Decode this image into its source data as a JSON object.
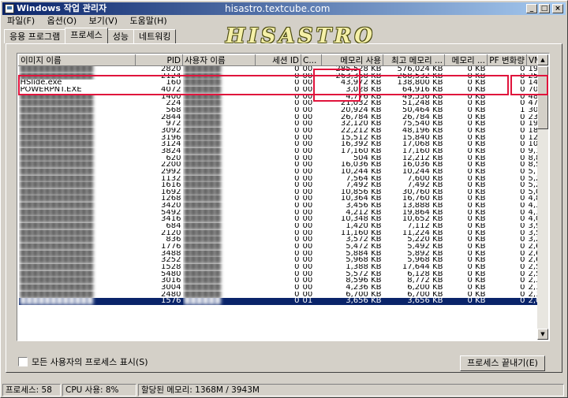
{
  "window": {
    "title": "Windows 작업 관리자",
    "watermark_url": "hisastro.textcube.com",
    "watermark_logo": "HISASTRO",
    "controls": [
      "_",
      "□",
      "×"
    ]
  },
  "menu": [
    "파일(F)",
    "옵션(O)",
    "보기(V)",
    "도움말(H)"
  ],
  "tabs": [
    {
      "label": "응용 프로그램",
      "active": false
    },
    {
      "label": "프로세스",
      "active": true
    },
    {
      "label": "성능",
      "active": false
    },
    {
      "label": "네트워킹",
      "active": false
    }
  ],
  "columns": [
    "이미지 이름",
    "PID",
    "사용자 이름",
    "세션 ID",
    "C...",
    "메모리 사용",
    "최고 메모리 ...",
    "메모리 ...",
    "PF 변화량",
    "VM 크"
  ],
  "rows": [
    {
      "name": "",
      "pid": "2820",
      "session": "0",
      "cpu": "00",
      "mem": "285,528 KB",
      "peak": "576,024 KB",
      "delta": "0 KB",
      "pf": "0",
      "vm": "199,400"
    },
    {
      "name": "",
      "pid": "2124",
      "session": "0",
      "cpu": "00",
      "mem": "263,368 KB",
      "peak": "268,532 KB",
      "delta": "0 KB",
      "pf": "0",
      "vm": "255,200"
    },
    {
      "name": "HSlide.exe",
      "pid": "160",
      "session": "0",
      "cpu": "00",
      "mem": "43,972 KB",
      "peak": "138,800 KB",
      "delta": "0 KB",
      "pf": "0",
      "vm": "147,880 K"
    },
    {
      "name": "POWERPNT.EXE",
      "pid": "4072",
      "session": "0",
      "cpu": "00",
      "mem": "3,028 KB",
      "peak": "64,916 KB",
      "delta": "0 KB",
      "pf": "0",
      "vm": "70,356"
    },
    {
      "name": "",
      "pid": "1400",
      "session": "0",
      "cpu": "00",
      "mem": "4,776 KB",
      "peak": "49,556 KB",
      "delta": "0 KB",
      "pf": "0",
      "vm": "48,876"
    },
    {
      "name": "",
      "pid": "224",
      "session": "0",
      "cpu": "00",
      "mem": "21,032 KB",
      "peak": "51,248 KB",
      "delta": "0 KB",
      "pf": "0",
      "vm": "47,836"
    },
    {
      "name": "",
      "pid": "568",
      "session": "0",
      "cpu": "00",
      "mem": "20,924 KB",
      "peak": "50,464 KB",
      "delta": "0 KB",
      "pf": "1",
      "vm": "30,708"
    },
    {
      "name": "",
      "pid": "2844",
      "session": "0",
      "cpu": "00",
      "mem": "26,784 KB",
      "peak": "26,784 KB",
      "delta": "0 KB",
      "pf": "0",
      "vm": "23,420"
    },
    {
      "name": "",
      "pid": "972",
      "session": "0",
      "cpu": "00",
      "mem": "32,120 KB",
      "peak": "75,540 KB",
      "delta": "0 KB",
      "pf": "0",
      "vm": "19,840"
    },
    {
      "name": "",
      "pid": "3092",
      "session": "0",
      "cpu": "00",
      "mem": "22,212 KB",
      "peak": "48,196 KB",
      "delta": "0 KB",
      "pf": "0",
      "vm": "18,360"
    },
    {
      "name": "",
      "pid": "3196",
      "session": "0",
      "cpu": "00",
      "mem": "15,512 KB",
      "peak": "15,840 KB",
      "delta": "0 KB",
      "pf": "0",
      "vm": "12,268"
    },
    {
      "name": "",
      "pid": "3124",
      "session": "0",
      "cpu": "00",
      "mem": "16,392 KB",
      "peak": "17,068 KB",
      "delta": "0 KB",
      "pf": "0",
      "vm": "10,028"
    },
    {
      "name": "",
      "pid": "3824",
      "session": "0",
      "cpu": "00",
      "mem": "17,160 KB",
      "peak": "17,160 KB",
      "delta": "0 KB",
      "pf": "0",
      "vm": "9,108"
    },
    {
      "name": "",
      "pid": "620",
      "session": "0",
      "cpu": "00",
      "mem": "504 KB",
      "peak": "12,212 KB",
      "delta": "0 KB",
      "pf": "0",
      "vm": "8,860"
    },
    {
      "name": "",
      "pid": "2200",
      "session": "0",
      "cpu": "00",
      "mem": "16,036 KB",
      "peak": "16,036 KB",
      "delta": "0 KB",
      "pf": "0",
      "vm": "8,512"
    },
    {
      "name": "",
      "pid": "2992",
      "session": "0",
      "cpu": "00",
      "mem": "10,244 KB",
      "peak": "10,244 KB",
      "delta": "0 KB",
      "pf": "0",
      "vm": "5,792"
    },
    {
      "name": "",
      "pid": "1132",
      "session": "0",
      "cpu": "00",
      "mem": "7,564 KB",
      "peak": "7,600 KB",
      "delta": "0 KB",
      "pf": "0",
      "vm": "5,288"
    },
    {
      "name": "",
      "pid": "1616",
      "session": "0",
      "cpu": "00",
      "mem": "7,492 KB",
      "peak": "7,492 KB",
      "delta": "0 KB",
      "pf": "0",
      "vm": "5,200"
    },
    {
      "name": "",
      "pid": "1692",
      "session": "0",
      "cpu": "00",
      "mem": "10,856 KB",
      "peak": "30,760 KB",
      "delta": "0 KB",
      "pf": "0",
      "vm": "5,032"
    },
    {
      "name": "",
      "pid": "1268",
      "session": "0",
      "cpu": "00",
      "mem": "10,364 KB",
      "peak": "16,760 KB",
      "delta": "0 KB",
      "pf": "0",
      "vm": "4,808"
    },
    {
      "name": "",
      "pid": "3420",
      "session": "0",
      "cpu": "00",
      "mem": "3,456 KB",
      "peak": "13,888 KB",
      "delta": "0 KB",
      "pf": "0",
      "vm": "4,300"
    },
    {
      "name": "",
      "pid": "5492",
      "session": "0",
      "cpu": "00",
      "mem": "4,212 KB",
      "peak": "19,864 KB",
      "delta": "0 KB",
      "pf": "0",
      "vm": "4,168"
    },
    {
      "name": "",
      "pid": "3416",
      "session": "0",
      "cpu": "00",
      "mem": "10,348 KB",
      "peak": "10,652 KB",
      "delta": "0 KB",
      "pf": "0",
      "vm": "4,000"
    },
    {
      "name": "",
      "pid": "684",
      "session": "0",
      "cpu": "00",
      "mem": "1,420 KB",
      "peak": "7,112 KB",
      "delta": "0 KB",
      "pf": "0",
      "vm": "3,968"
    },
    {
      "name": "",
      "pid": "2120",
      "session": "0",
      "cpu": "00",
      "mem": "11,160 KB",
      "peak": "11,224 KB",
      "delta": "0 KB",
      "pf": "0",
      "vm": "3,500"
    },
    {
      "name": "",
      "pid": "836",
      "session": "0",
      "cpu": "00",
      "mem": "3,572 KB",
      "peak": "5,220 KB",
      "delta": "0 KB",
      "pf": "0",
      "vm": "3,232"
    },
    {
      "name": "",
      "pid": "1776",
      "session": "0",
      "cpu": "00",
      "mem": "5,472 KB",
      "peak": "5,492 KB",
      "delta": "0 KB",
      "pf": "0",
      "vm": "2,620"
    },
    {
      "name": "",
      "pid": "3488",
      "session": "0",
      "cpu": "00",
      "mem": "5,884 KB",
      "peak": "5,892 KB",
      "delta": "0 KB",
      "pf": "0",
      "vm": "2,608"
    },
    {
      "name": "",
      "pid": "3252",
      "session": "0",
      "cpu": "00",
      "mem": "5,968 KB",
      "peak": "5,968 KB",
      "delta": "0 KB",
      "pf": "0",
      "vm": "2,600"
    },
    {
      "name": "",
      "pid": "1528",
      "session": "0",
      "cpu": "00",
      "mem": "1,388 KB",
      "peak": "17,644 KB",
      "delta": "0 KB",
      "pf": "0",
      "vm": "2,528"
    },
    {
      "name": "",
      "pid": "5480",
      "session": "0",
      "cpu": "00",
      "mem": "5,572 KB",
      "peak": "6,128 KB",
      "delta": "0 KB",
      "pf": "0",
      "vm": "2,520"
    },
    {
      "name": "",
      "pid": "3016",
      "session": "0",
      "cpu": "00",
      "mem": "8,596 KB",
      "peak": "8,772 KB",
      "delta": "0 KB",
      "pf": "0",
      "vm": "2,372"
    },
    {
      "name": "",
      "pid": "3004",
      "session": "0",
      "cpu": "00",
      "mem": "4,236 KB",
      "peak": "6,200 KB",
      "delta": "0 KB",
      "pf": "0",
      "vm": "2,144"
    },
    {
      "name": "",
      "pid": "2480",
      "session": "0",
      "cpu": "00",
      "mem": "6,700 KB",
      "peak": "6,700 KB",
      "delta": "0 KB",
      "pf": "0",
      "vm": "2,124"
    },
    {
      "name": "",
      "pid": "1576",
      "session": "0",
      "cpu": "01",
      "mem": "3,656 KB",
      "peak": "3,656 KB",
      "delta": "0 KB",
      "pf": "0",
      "vm": "2,076 K",
      "selected": true
    }
  ],
  "show_all_users_label": "모든 사용자의 프로세스 표시(S)",
  "end_process_label": "프로세스 끝내기(E)",
  "status": {
    "processes": "프로세스: 58",
    "cpu": "CPU 사용: 8%",
    "memory": "할당된 메모리: 1368M / 3943M"
  },
  "colors": {
    "titlebar": "#0a246a",
    "selection": "#0a246a",
    "highlight_box": "#e0143c",
    "face": "#d4d0c8"
  }
}
